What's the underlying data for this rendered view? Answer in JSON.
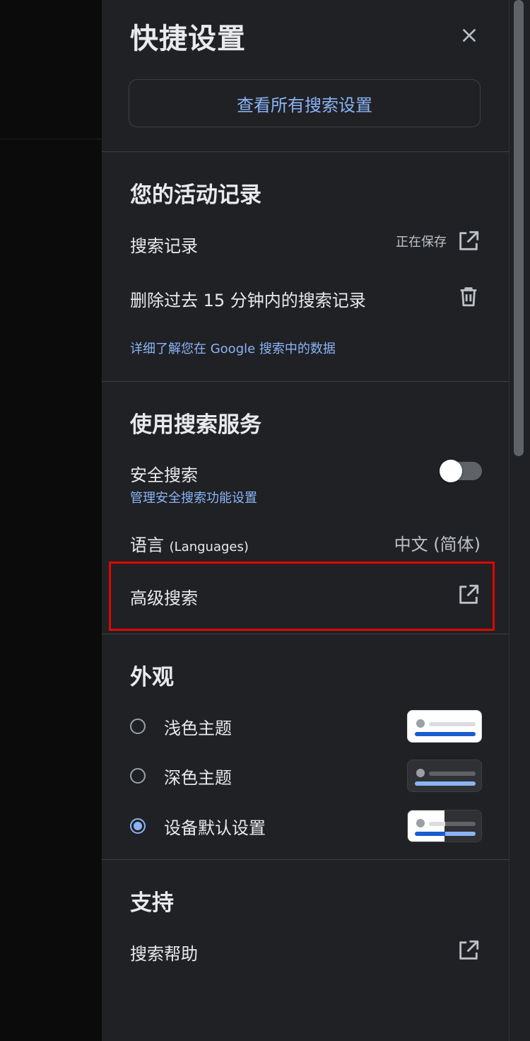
{
  "panel": {
    "title": "快捷设置",
    "all_settings_label": "查看所有搜索设置"
  },
  "activity": {
    "heading": "您的活动记录",
    "search_history_label": "搜索记录",
    "search_history_status": "正在保存",
    "delete_last_15_label": "删除过去 15 分钟内的搜索记录",
    "learn_more_link": "详细了解您在 Google 搜索中的数据"
  },
  "search_services": {
    "heading": "使用搜索服务",
    "safesearch_label": "安全搜索",
    "safesearch_enabled": false,
    "safesearch_manage_link": "管理安全搜索功能设置",
    "language_label": "语言",
    "language_label_en": "(Languages)",
    "language_value": "中文 (简体)",
    "advanced_search_label": "高级搜索"
  },
  "appearance": {
    "heading": "外观",
    "options": [
      {
        "label": "浅色主题",
        "selected": false
      },
      {
        "label": "深色主题",
        "selected": false
      },
      {
        "label": "设备默认设置",
        "selected": true
      }
    ]
  },
  "support": {
    "heading": "支持",
    "help_label": "搜索帮助"
  },
  "colors": {
    "panel_bg": "#202124",
    "link": "#8ab4f8",
    "highlight": "#e10600"
  }
}
